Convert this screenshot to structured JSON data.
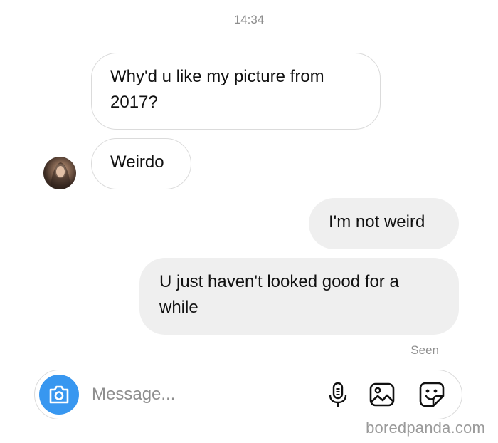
{
  "header": {
    "time": "14:34"
  },
  "messages": [
    {
      "sender": "them",
      "text": "Why'd u like my picture from 2017?"
    },
    {
      "sender": "them",
      "text": "Weirdo"
    },
    {
      "sender": "me",
      "text": "I'm not weird"
    },
    {
      "sender": "me",
      "text": "U just haven't looked good for a while"
    }
  ],
  "status": {
    "seen": "Seen"
  },
  "composer": {
    "placeholder": "Message...",
    "value": ""
  },
  "icons": {
    "camera": "camera-icon",
    "mic": "microphone-icon",
    "gallery": "image-icon",
    "sticker": "sticker-icon"
  },
  "colors": {
    "accent": "#3897f0",
    "outgoing_bubble": "#efefef",
    "muted_text": "#8e8e8e"
  },
  "watermark": "boredpanda.com"
}
